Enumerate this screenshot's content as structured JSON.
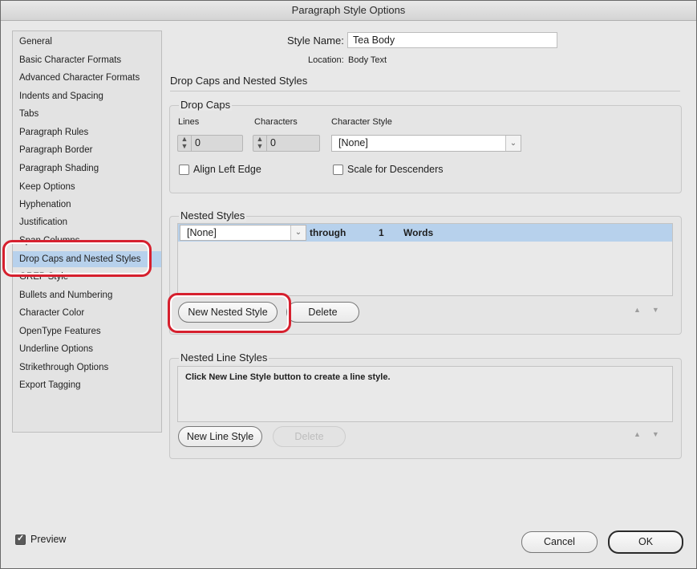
{
  "window": {
    "title": "Paragraph Style Options"
  },
  "sidebar": {
    "items": [
      {
        "label": "General"
      },
      {
        "label": "Basic Character Formats"
      },
      {
        "label": "Advanced Character Formats"
      },
      {
        "label": "Indents and Spacing"
      },
      {
        "label": "Tabs"
      },
      {
        "label": "Paragraph Rules"
      },
      {
        "label": "Paragraph Border"
      },
      {
        "label": "Paragraph Shading"
      },
      {
        "label": "Keep Options"
      },
      {
        "label": "Hyphenation"
      },
      {
        "label": "Justification"
      },
      {
        "label": "Span Columns"
      },
      {
        "label": "Drop Caps and Nested Styles"
      },
      {
        "label": "GREP Style"
      },
      {
        "label": "Bullets and Numbering"
      },
      {
        "label": "Character Color"
      },
      {
        "label": "OpenType Features"
      },
      {
        "label": "Underline Options"
      },
      {
        "label": "Strikethrough Options"
      },
      {
        "label": "Export Tagging"
      }
    ],
    "selected": "Drop Caps and Nested Styles"
  },
  "header": {
    "style_name_label": "Style Name:",
    "style_name_value": "Tea Body",
    "location_label": "Location:",
    "location_value": "Body Text",
    "section_title": "Drop Caps and Nested Styles"
  },
  "drop_caps": {
    "title": "Drop Caps",
    "lines_label": "Lines",
    "lines_value": "0",
    "characters_label": "Characters",
    "characters_value": "0",
    "char_style_label": "Character Style",
    "char_style_value": "[None]",
    "align_left_edge_label": "Align Left Edge",
    "scale_descenders_label": "Scale for Descenders"
  },
  "nested_styles": {
    "title": "Nested Styles",
    "row": {
      "style": "[None]",
      "mode": "through",
      "count": "1",
      "unit": "Words"
    },
    "new_button": "New Nested Style",
    "delete_button": "Delete"
  },
  "nested_line_styles": {
    "title": "Nested Line Styles",
    "message": "Click New Line Style button to create a line style.",
    "new_button": "New Line Style",
    "delete_button": "Delete"
  },
  "footer": {
    "preview_label": "Preview",
    "cancel_label": "Cancel",
    "ok_label": "OK"
  },
  "colors": {
    "selection": "#b7d1ec",
    "callout": "#d6202e"
  }
}
